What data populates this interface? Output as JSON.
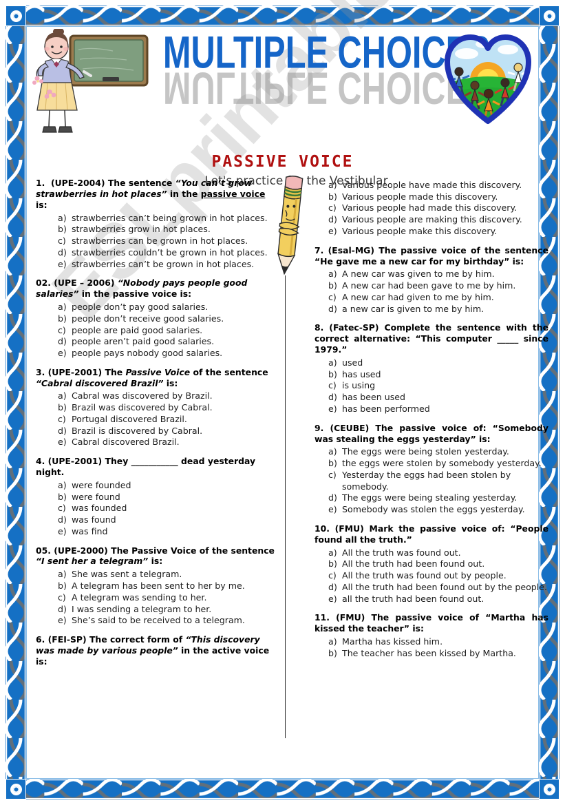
{
  "header": {
    "title": "MULTIPLE CHOICES",
    "subtitle": "Let's practice for the Vestibular",
    "section_heading": "PASSIVE VOICE",
    "watermark": "ESLprintables.com",
    "teacher_art_name": "teacher-at-chalkboard-illustration",
    "heart_art_name": "heart-with-children-logo",
    "pencil_art_name": "cartoon-pencil-character"
  },
  "colors": {
    "border_blue": "#1570c4",
    "title_blue": "#1565c8",
    "heading_red": "#b01010",
    "chalkboard_green": "#7f9e7f",
    "pencil_yellow": "#f2cf5e"
  },
  "questions_left": [
    {
      "number": "1.",
      "source": "(UPE-2004)",
      "stem_html": "<b>1.&nbsp; (UPE-2004) The sentence <i>“You can’t grow strawberries in hot places”</i> in the <u>passive voice</u> is:</b>",
      "options": [
        {
          "label": "a)",
          "text": "strawberries can’t being grown in hot places."
        },
        {
          "label": "b)",
          "text": "strawberries grow in hot places."
        },
        {
          "label": "c)",
          "text": " strawberries can be grown in hot places."
        },
        {
          "label": "d)",
          "text": "strawberries couldn’t be grown in hot places."
        },
        {
          "label": "e)",
          "text": "strawberries can’t be grown in hot places."
        }
      ]
    },
    {
      "number": "02.",
      "source": "(UPE – 2006)",
      "stem_html": "<b>02. (UPE – 2006) <i>“Nobody pays people good salaries”</i> in the passive voice is:</b>",
      "options": [
        {
          "label": "a)",
          "text": "people don’t pay good salaries."
        },
        {
          "label": "b)",
          "text": "people don’t receive good salaries."
        },
        {
          "label": "c)",
          "text": "people are paid good salaries."
        },
        {
          "label": "d)",
          "text": "people aren’t paid good salaries."
        },
        {
          "label": "e)",
          "text": "people pays nobody good salaries."
        }
      ]
    },
    {
      "number": "3.",
      "source": "(UPE-2001)",
      "stem_html": "<b>3. (UPE-2001) The <i>Passive Voice</i> of the sentence <i>“Cabral discovered Brazil”</i> is:</b>",
      "options": [
        {
          "label": "a)",
          "text": "Cabral was discovered by Brazil."
        },
        {
          "label": "b)",
          "text": "Brazil was discovered by Cabral."
        },
        {
          "label": "c)",
          "text": " Portugal discovered Brazil."
        },
        {
          "label": "d)",
          "text": "Brazil is discovered by Cabral."
        },
        {
          "label": "e)",
          "text": "Cabral discovered Brazil."
        }
      ]
    },
    {
      "number": "4.",
      "source": "(UPE-2001)",
      "stem_html": "<b>4. (UPE-2001) They ___________ dead yesterday night.</b>",
      "options": [
        {
          "label": "a)",
          "text": "were founded"
        },
        {
          "label": "b)",
          "text": "were found"
        },
        {
          "label": "c)",
          "text": "was founded"
        },
        {
          "label": "d)",
          "text": " was found"
        },
        {
          "label": "e)",
          "text": " was find"
        }
      ]
    },
    {
      "number": "05.",
      "source": "(UPE-2000)",
      "stem_html": "<b>05. (UPE-2000) The Passive Voice of the sentence <i>“I sent her a telegram”</i> is:</b>",
      "options": [
        {
          "label": "a)",
          "text": "She was sent a telegram."
        },
        {
          "label": "b)",
          "text": "A telegram has been sent to her by me."
        },
        {
          "label": "c)",
          "text": "A telegram was sending to her."
        },
        {
          "label": "d)",
          "text": " I was sending a telegram to her."
        },
        {
          "label": "e)",
          "text": "She’s said to be received to a telegram."
        }
      ]
    },
    {
      "number": "6.",
      "source": "(FEI-SP)",
      "stem_html": "<b>6. (FEI-SP) The correct form of <i>“This discovery was made by various people”</i> in the active voice is:</b>",
      "options": []
    }
  ],
  "questions_right": [
    {
      "number": "",
      "source": "",
      "stem_html": "",
      "options": [
        {
          "label": "a)",
          "text": "Various people have made this discovery."
        },
        {
          "label": "b)",
          "text": "Various people made this discovery."
        },
        {
          "label": "c)",
          "text": "Various people had made this discovery."
        },
        {
          "label": "d)",
          "text": "Various people are making this discovery."
        },
        {
          "label": "e)",
          "text": "Various people make this discovery."
        }
      ]
    },
    {
      "number": "7.",
      "source": "(Esal-MG)",
      "stem_html": "<b>7. (Esal-MG) The passive voice of the sentence “He gave me a new car for my birthday” is:</b>",
      "options": [
        {
          "label": "a)",
          "text": "A new car was given to me by him."
        },
        {
          "label": "b)",
          "text": "A new car had been gave to me by him."
        },
        {
          "label": "c)",
          "text": "A new car had given to me by him."
        },
        {
          "label": "d)",
          "text": "a new car is given to me by him."
        }
      ]
    },
    {
      "number": "8.",
      "source": "(Fatec-SP)",
      "stem_html": "<b>8. (Fatec-SP) Complete the sentence with the correct alternative: “This computer _____ since 1979.”</b>",
      "options": [
        {
          "label": "a)",
          "text": "used"
        },
        {
          "label": "b)",
          "text": "has used"
        },
        {
          "label": "c)",
          "text": "is using"
        },
        {
          "label": "d)",
          "text": "has been used"
        },
        {
          "label": "e)",
          "text": "has been performed"
        }
      ]
    },
    {
      "number": "9.",
      "source": "(CEUBE)",
      "stem_html": "<b>9. (CEUBE) The passive voice of: “Somebody was stealing the eggs yesterday” is:</b>",
      "options": [
        {
          "label": "a)",
          "text": "The eggs were being stolen yesterday."
        },
        {
          "label": "b)",
          "text": "the eggs were stolen by somebody yesterday."
        },
        {
          "label": "c)",
          "text": "Yesterday the eggs had been stolen by somebody."
        },
        {
          "label": "d)",
          "text": "The eggs were being stealing yesterday."
        },
        {
          "label": "e)",
          "text": "Somebody was stolen the eggs yesterday."
        }
      ]
    },
    {
      "number": "10.",
      "source": "(FMU)",
      "stem_html": "<b>10. (FMU) Mark the passive voice of: “People found all the truth.”</b>",
      "options": [
        {
          "label": "a)",
          "text": "All the truth was found out."
        },
        {
          "label": "b)",
          "text": "All the truth had been found out."
        },
        {
          "label": "c)",
          "text": "All the truth was found out by people."
        },
        {
          "label": "d)",
          "text": "All the truth had been found out by the people."
        },
        {
          "label": "e)",
          "text": "all the truth had been found out."
        }
      ]
    },
    {
      "number": "11.",
      "source": "(FMU)",
      "stem_html": "<b>11. (FMU) The passive voice of “Martha has kissed the teacher” is:</b>",
      "options": [
        {
          "label": "a)",
          "text": "Martha has kissed him."
        },
        {
          "label": "b)",
          "text": "The teacher has been kissed by Martha."
        }
      ]
    }
  ]
}
